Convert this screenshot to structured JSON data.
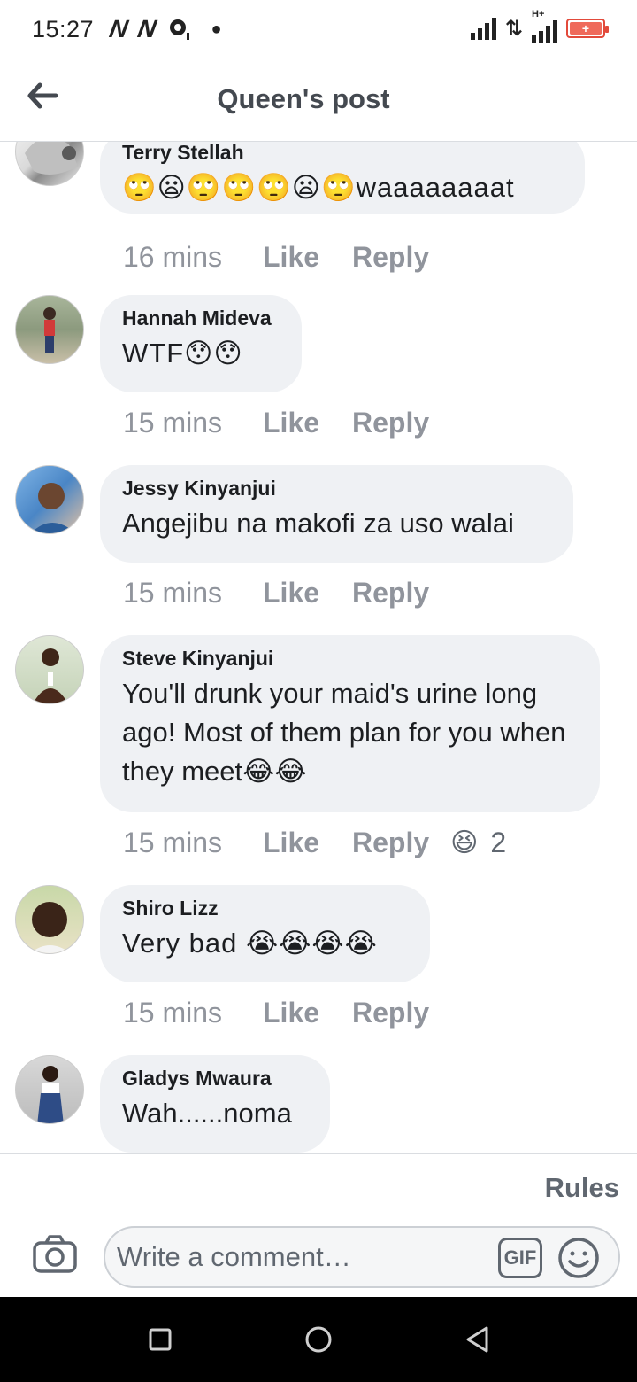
{
  "status_bar": {
    "time": "15:27",
    "left_icons": [
      "N",
      "N"
    ],
    "network_type": "H+",
    "battery_symbol": "+"
  },
  "header": {
    "title": "Queen's post"
  },
  "comments": [
    {
      "author": "Terry Stellah",
      "text": "🙄😦🙄🙄🙄😦🙄waaaaaaaat",
      "time": "16 mins",
      "like": "Like",
      "reply": "Reply",
      "avatar_icon": "avatar-terry"
    },
    {
      "author": "Hannah Mideva",
      "text": "WTF😯😯",
      "time": "15 mins",
      "like": "Like",
      "reply": "Reply",
      "avatar_icon": "avatar-hannah"
    },
    {
      "author": "Jessy Kinyanjui",
      "text": "Angejibu na makofi za uso walai",
      "time": "15 mins",
      "like": "Like",
      "reply": "Reply",
      "avatar_icon": "avatar-jessy"
    },
    {
      "author": "Steve Kinyanjui",
      "text": "You'll drunk your maid's urine long ago! Most of them plan for you when they meet😂😂",
      "time": "15 mins",
      "like": "Like",
      "reply": "Reply",
      "reaction_emoji": "😆",
      "reaction_count": "2",
      "avatar_icon": "avatar-steve"
    },
    {
      "author": "Shiro Lizz",
      "text": "Very bad 😭😭😭😭",
      "time": "15 mins",
      "like": "Like",
      "reply": "Reply",
      "avatar_icon": "avatar-shiro"
    },
    {
      "author": "Gladys Mwaura",
      "text": "Wah......noma",
      "avatar_icon": "avatar-gladys"
    }
  ],
  "footer": {
    "rules": "Rules",
    "input_placeholder": "Write a comment…",
    "gif_label": "GIF"
  },
  "colors": {
    "bubble": "#eff1f4",
    "meta_text": "#90949c",
    "title_text": "#444950",
    "battery": "#e24a3b"
  }
}
